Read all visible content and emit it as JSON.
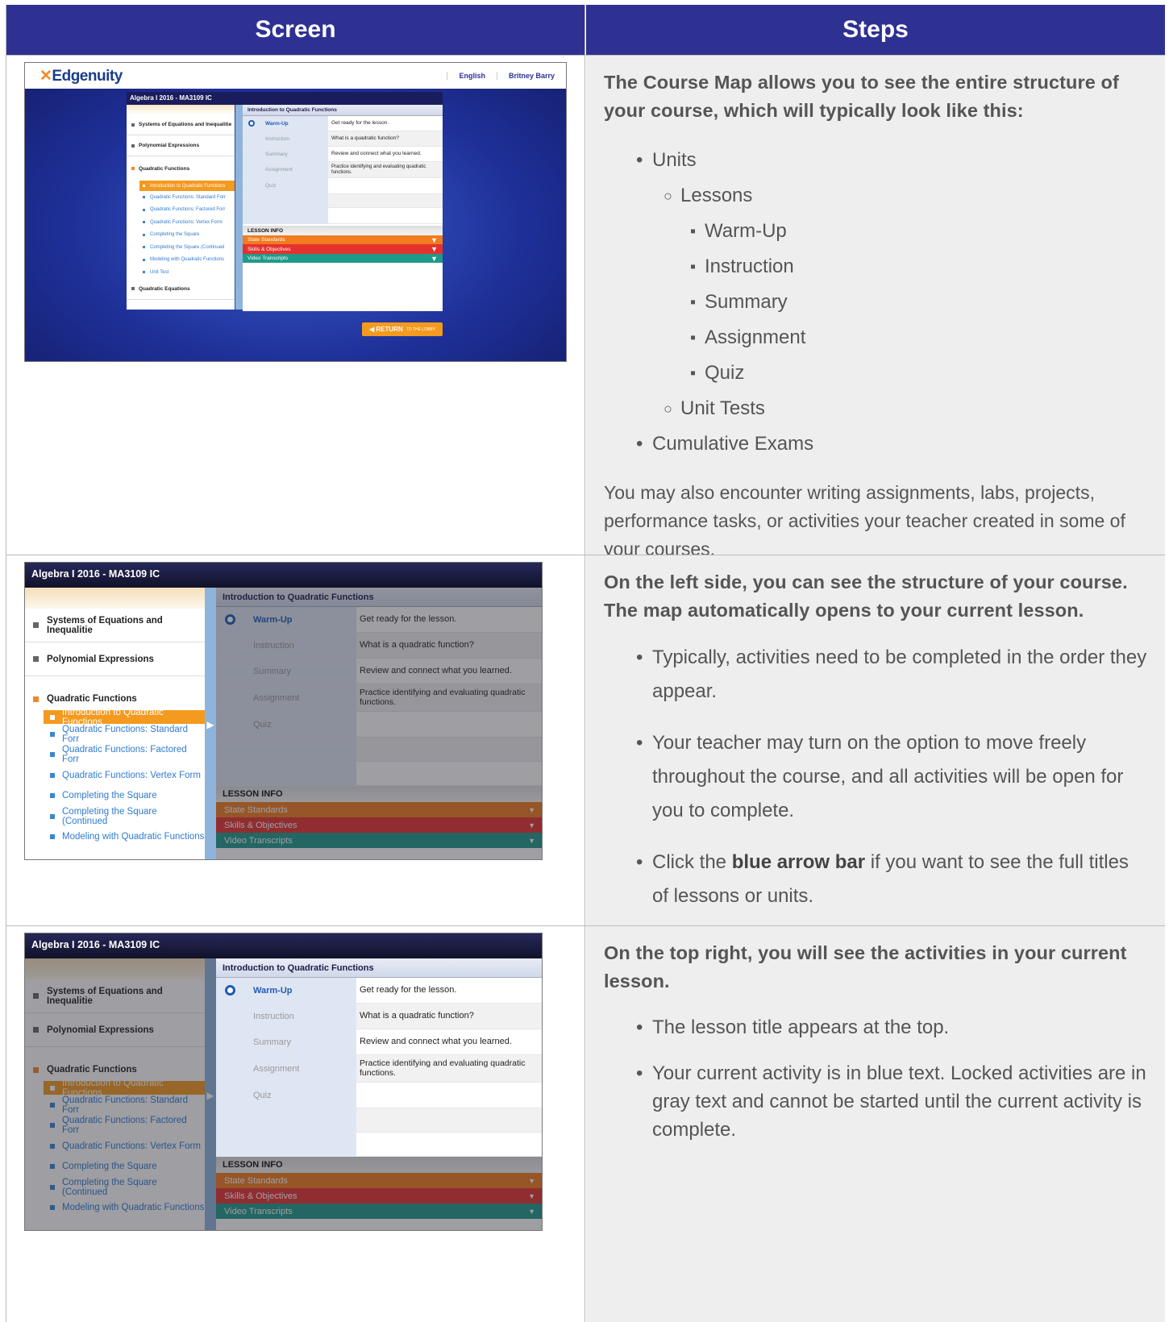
{
  "headers": {
    "screen": "Screen",
    "steps": "Steps"
  },
  "app": {
    "logo": "Edgenuity",
    "language": "English",
    "user": "Britney Barry",
    "course_title": "Algebra I 2016 - MA3109 IC",
    "return_button": "RETURN",
    "return_sub": "TO THE LOBBY",
    "units": [
      "Systems of Equations and Inequalitie",
      "Polynomial Expressions",
      "Quadratic Functions",
      "Quadratic Equations"
    ],
    "lessons": [
      "Introduction to Quadratic Functions",
      "Quadratic Functions: Standard Forr",
      "Quadratic Functions: Factored Forr",
      "Quadratic Functions: Vertex Form",
      "Completing the Square",
      "Completing the Square (Continued",
      "Modeling with Quadratic Functions",
      "Unit Test"
    ],
    "lesson_title": "Introduction to Quadratic Functions",
    "activities": [
      {
        "name": "Warm-Up",
        "desc": "Get ready for the lesson."
      },
      {
        "name": "Instruction",
        "desc": "What is a quadratic function?"
      },
      {
        "name": "Summary",
        "desc": "Review and connect what you learned."
      },
      {
        "name": "Assignment",
        "desc": "Practice identifying and evaluating quadratic functions."
      },
      {
        "name": "Quiz",
        "desc": ""
      }
    ],
    "lesson_info": "LESSON INFO",
    "info_bars": [
      "State Standards",
      "Skills & Objectives",
      "Video Transcripts"
    ],
    "colors": {
      "navy": "#2e3191",
      "orange": "#f39a1f",
      "red": "#e5322e",
      "teal": "#1f9a8a"
    }
  },
  "row1": {
    "lead": "The Course Map allows you to see the entire structure of your course, which will typically look like this:",
    "outline": {
      "units": "Units",
      "lessons": "Lessons",
      "items": [
        "Warm-Up",
        "Instruction",
        "Summary",
        "Assignment",
        "Quiz"
      ],
      "unit_tests": "Unit Tests",
      "cumulative": "Cumulative Exams"
    },
    "note": "You may also encounter writing assignments, labs, projects, performance tasks, or activities your teacher created in some of your courses."
  },
  "row2": {
    "lead": "On the left side, you can see the structure of your course. The map automatically opens to your current lesson.",
    "b1": "Typically, activities need to be completed in the order they appear.",
    "b2": "Your teacher may turn on the option to move freely throughout the course, and all activities will be open for you to complete.",
    "b3_pre": "Click the ",
    "b3_bold": "blue arrow bar",
    "b3_post": " if you want to see the full titles of lessons or units."
  },
  "row3": {
    "lead": "On the top right, you will see the activities in your current lesson.",
    "b1": "The lesson title appears at the top.",
    "b2": "Your current activity is in blue text. Locked activities are in gray text and cannot be started until the current activity is complete."
  }
}
